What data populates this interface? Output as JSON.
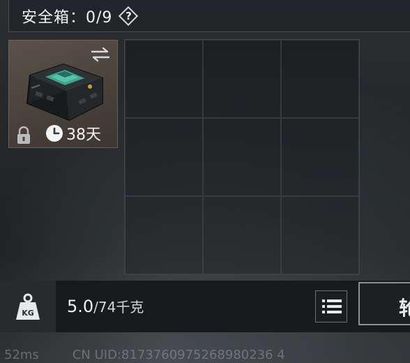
{
  "header": {
    "title": "安全箱：0/9",
    "help_glyph": "?"
  },
  "item": {
    "name": "secure-case",
    "timer": "38天",
    "icons": [
      "swap-icon",
      "lock-icon",
      "clock-icon"
    ]
  },
  "grid": {
    "rows": 3,
    "cols": 3
  },
  "weight": {
    "icon_label": "KG",
    "current": "5.0",
    "capacity": "/74千克"
  },
  "bottom_button_partial": "轮",
  "footer": {
    "ping": "52ms",
    "uid": "CN UID:8173760975268980236 4"
  },
  "colors": {
    "accent_green": "#3fa58c",
    "item_bg": "#4a423b"
  }
}
